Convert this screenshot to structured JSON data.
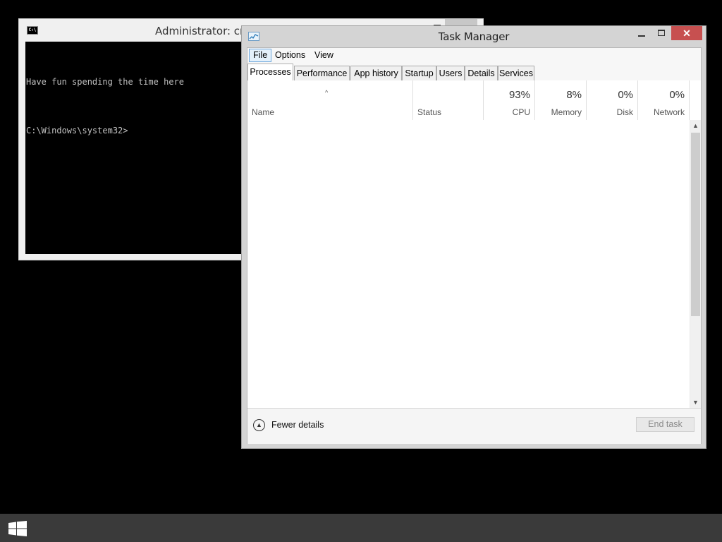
{
  "cmd": {
    "title": "Administrator: cmd",
    "lines": [
      "Have fun spending the time here",
      "C:\\Windows\\system32>"
    ]
  },
  "taskmanager": {
    "title": "Task Manager",
    "menu": [
      "File",
      "Options",
      "View"
    ],
    "tabs": [
      "Processes",
      "Performance",
      "App history",
      "Startup",
      "Users",
      "Details",
      "Services"
    ],
    "columns": {
      "name": "Name",
      "status": "Status",
      "cpu": {
        "pct": "93%",
        "label": "CPU"
      },
      "memory": {
        "pct": "8%",
        "label": "Memory"
      },
      "disk": {
        "pct": "0%",
        "label": "Disk"
      },
      "network": {
        "pct": "0%",
        "label": "Network"
      }
    },
    "fewer_details": "Fewer details",
    "end_task": "End task"
  },
  "colors": {
    "close_red": "#c75050",
    "desktop": "#000000",
    "taskbar": "#3a3a3a"
  }
}
